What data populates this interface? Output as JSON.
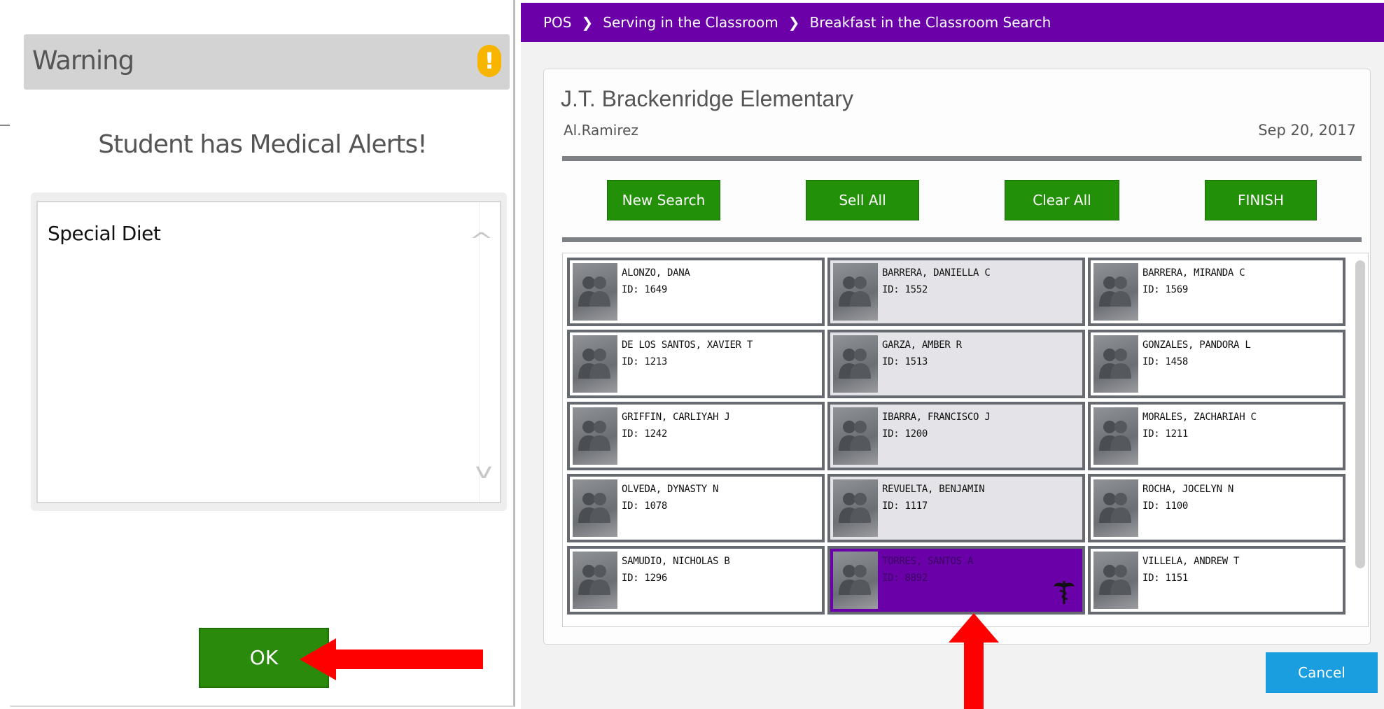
{
  "dialog": {
    "title": "Warning",
    "warning_icon": "exclamation-icon",
    "heading": "Student has Medical Alerts!",
    "alert_text": "Special Diet",
    "ok_label": "OK"
  },
  "pos": {
    "breadcrumb": [
      "POS",
      "Serving in the Classroom",
      "Breakfast in the Classroom Search"
    ],
    "school_name": "J.T. Brackenridge Elementary",
    "user_name": "Al.Ramirez",
    "date": "Sep 20, 2017",
    "actions": {
      "new_search": "New Search",
      "sell_all": "Sell All",
      "clear_all": "Clear All",
      "finish": "FINISH"
    },
    "cancel_label": "Cancel",
    "students": [
      {
        "name": "ALONZO, DANA",
        "id": "ID: 1649"
      },
      {
        "name": "BARRERA, DANIELLA C",
        "id": "ID: 1552"
      },
      {
        "name": "BARRERA, MIRANDA C",
        "id": "ID: 1569"
      },
      {
        "name": "DE LOS SANTOS, XAVIER T",
        "id": "ID: 1213"
      },
      {
        "name": "GARZA, AMBER R",
        "id": "ID: 1513"
      },
      {
        "name": "GONZALES, PANDORA L",
        "id": "ID: 1458"
      },
      {
        "name": "GRIFFIN, CARLIYAH J",
        "id": "ID: 1242"
      },
      {
        "name": "IBARRA, FRANCISCO J",
        "id": "ID: 1200"
      },
      {
        "name": "MORALES, ZACHARIAH C",
        "id": "ID: 1211"
      },
      {
        "name": "OLVEDA, DYNASTY N",
        "id": "ID: 1078"
      },
      {
        "name": "REVUELTA, BENJAMIN",
        "id": "ID: 1117"
      },
      {
        "name": "ROCHA, JOCELYN N",
        "id": "ID: 1100"
      },
      {
        "name": "SAMUDIO, NICHOLAS B",
        "id": "ID: 1296"
      },
      {
        "name": "TORRES, SANTOS A",
        "id": "ID: 8892",
        "selected": true,
        "medical_alert": true
      },
      {
        "name": "VILLELA, ANDREW T",
        "id": "ID: 1151"
      }
    ]
  },
  "colors": {
    "breadcrumb_bar": "#6b00a8",
    "selected_card": "#6a00a8",
    "action_button": "#239108",
    "cancel_button": "#1a9ee0",
    "annotation_arrow": "#ff0000",
    "warning_icon": "#f7b500"
  }
}
